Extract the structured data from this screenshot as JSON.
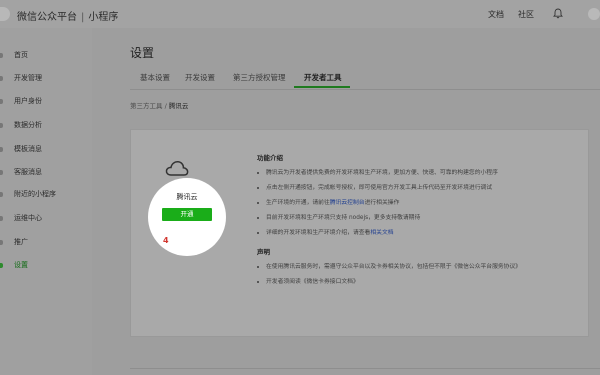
{
  "brand": {
    "name": "微信公众平台",
    "separator": "|",
    "product": "小程序"
  },
  "topnav": {
    "docs": "文档",
    "community": "社区"
  },
  "sidebar": {
    "items": [
      {
        "label": "首页"
      },
      {
        "label": "开发管理"
      },
      {
        "label": "用户身份"
      },
      {
        "label": "数据分析"
      },
      {
        "label": "模板消息"
      },
      {
        "label": "客服消息"
      },
      {
        "label": "附近的小程序"
      },
      {
        "label": "运维中心"
      },
      {
        "label": "推广"
      },
      {
        "label": "设置"
      }
    ],
    "active": "设置"
  },
  "page": {
    "title": "设置",
    "tabs": [
      {
        "label": "基本设置"
      },
      {
        "label": "开发设置"
      },
      {
        "label": "第三方授权管理"
      },
      {
        "label": "开发者工具"
      }
    ],
    "active_tab": "开发者工具",
    "breadcrumb": {
      "parent": "第三方工具",
      "sep": "/",
      "current": "腾讯云"
    }
  },
  "card": {
    "service_name": "腾讯云",
    "enable_button": "开通",
    "step_badge": "4",
    "features_title": "功能介绍",
    "features": [
      {
        "text": "腾讯云为开发者提供免费的开发环境和生产环境，更加方便、快速、可靠的构建您的小程序"
      },
      {
        "text": "点击左侧开通按钮，完成帐号授权，即可使用官方开发工具上传代码至开发环境进行调试"
      },
      {
        "text_before": "生产环境的开通，请前往",
        "link": "腾讯云控制台",
        "text_after": "进行相关操作"
      },
      {
        "text": "目前开发环境和生产环境只支持 nodejs，更多支持敬请期待"
      },
      {
        "text_before": "详细的开发环境和生产环境介绍，请查看",
        "link": "相关文档",
        "text_after": ""
      }
    ],
    "statement_title": "声明",
    "statements": [
      {
        "text": "在使用腾讯云服务时，需遵守公众平台以及卡券相关协议，包括但不限于《微信公众平台服务协议》"
      },
      {
        "text": "开发者须阅读《微信卡券接口文档》"
      }
    ]
  },
  "icons": {
    "logo": "wechat-logo",
    "bell": "bell-icon",
    "cloud": "cloud-icon"
  }
}
